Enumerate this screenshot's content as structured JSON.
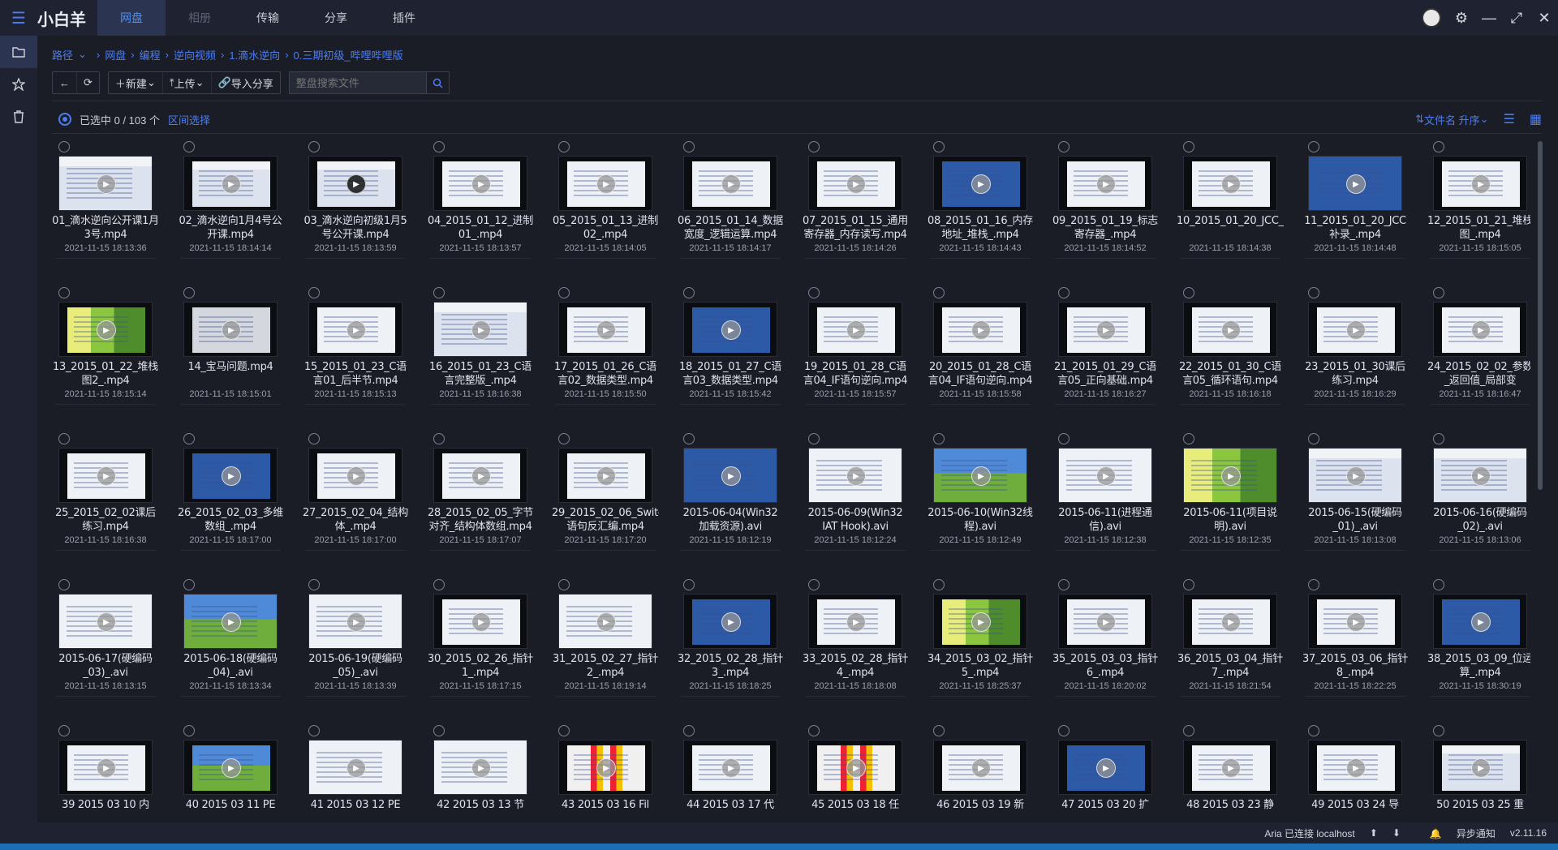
{
  "app": {
    "name": "小白羊"
  },
  "nav": {
    "tabs": [
      "网盘",
      "相册",
      "传输",
      "分享",
      "插件"
    ]
  },
  "breadcrumb": [
    "路径",
    "网盘",
    "编程",
    "逆向视频",
    "1.滴水逆向",
    "0.三期初级_哔哩哔哩版"
  ],
  "toolbar": {
    "new_label": "新建",
    "upload_label": "上传",
    "import_label": "导入分享",
    "search_placeholder": "整盘搜索文件"
  },
  "selection": {
    "count_text": "已选中 0 / 103 个",
    "range_label": "区间选择",
    "sort_label": "文件名 升序"
  },
  "files": [
    {
      "name": "01_滴水逆向公开课1月3号.mp4",
      "date": "2021-11-15 18:13:36",
      "style": "s-win",
      "full": true
    },
    {
      "name": "02_滴水逆向1月4号公开课.mp4",
      "date": "2021-11-15 18:14:14",
      "style": "s-win",
      "full": false
    },
    {
      "name": "03_滴水逆向初级1月5号公开课.mp4",
      "date": "2021-11-15 18:13:59",
      "style": "s-win",
      "full": false
    },
    {
      "name": "04_2015_01_12_进制01_.mp4",
      "date": "2021-11-15 18:13:57",
      "style": "s-white",
      "full": false
    },
    {
      "name": "05_2015_01_13_进制02_.mp4",
      "date": "2021-11-15 18:14:05",
      "style": "s-white",
      "full": false
    },
    {
      "name": "06_2015_01_14_数据宽度_逻辑运算.mp4",
      "date": "2021-11-15 18:14:17",
      "style": "s-white",
      "full": false
    },
    {
      "name": "07_2015_01_15_通用寄存器_内存读写.mp4",
      "date": "2021-11-15 18:14:26",
      "style": "s-white",
      "full": false
    },
    {
      "name": "08_2015_01_16_内存地址_堆栈_.mp4",
      "date": "2021-11-15 18:14:43",
      "style": "s-blue",
      "full": false
    },
    {
      "name": "09_2015_01_19_标志寄存器_.mp4",
      "date": "2021-11-15 18:14:52",
      "style": "s-white",
      "full": false
    },
    {
      "name": "10_2015_01_20_JCC_.mp4",
      "date": "2021-11-15 18:14:38",
      "style": "s-white",
      "full": false
    },
    {
      "name": "11_2015_01_20_JCC补录_.mp4",
      "date": "2021-11-15 18:14:48",
      "style": "s-blue",
      "full": true
    },
    {
      "name": "12_2015_01_21_堆栈图_.mp4",
      "date": "2021-11-15 18:15:05",
      "style": "s-white",
      "full": false
    },
    {
      "name": "13_2015_01_22_堆栈图2_.mp4",
      "date": "2021-11-15 18:15:14",
      "style": "s-green",
      "full": false
    },
    {
      "name": "14_宝马问题.mp4",
      "date": "2021-11-15 18:15:01",
      "style": "s-gray",
      "full": false
    },
    {
      "name": "15_2015_01_23_C语言01_后半节.mp4",
      "date": "2021-11-15 18:15:13",
      "style": "s-white",
      "full": false
    },
    {
      "name": "16_2015_01_23_C语言完整版_.mp4",
      "date": "2021-11-15 18:16:38",
      "style": "s-win",
      "full": true
    },
    {
      "name": "17_2015_01_26_C语言02_数据类型.mp4",
      "date": "2021-11-15 18:15:50",
      "style": "s-white",
      "full": false
    },
    {
      "name": "18_2015_01_27_C语言03_数据类型.mp4",
      "date": "2021-11-15 18:15:42",
      "style": "s-blue",
      "full": false
    },
    {
      "name": "19_2015_01_28_C语言04_IF语句逆向.mp4",
      "date": "2021-11-15 18:15:57",
      "style": "s-white",
      "full": false
    },
    {
      "name": "20_2015_01_28_C语言04_IF语句逆向.mp4",
      "date": "2021-11-15 18:15:58",
      "style": "s-white",
      "full": false
    },
    {
      "name": "21_2015_01_29_C语言05_正向基础.mp4",
      "date": "2021-11-15 18:16:27",
      "style": "s-white",
      "full": false
    },
    {
      "name": "22_2015_01_30_C语言05_循环语句.mp4",
      "date": "2021-11-15 18:16:18",
      "style": "s-white",
      "full": false
    },
    {
      "name": "23_2015_01_30课后练习.mp4",
      "date": "2021-11-15 18:16:29",
      "style": "s-white",
      "full": false
    },
    {
      "name": "24_2015_02_02_参数_返回值_局部变量.mp4",
      "date": "2021-11-15 18:16:47",
      "style": "s-white",
      "full": false
    },
    {
      "name": "25_2015_02_02课后练习.mp4",
      "date": "2021-11-15 18:16:38",
      "style": "s-white",
      "full": false
    },
    {
      "name": "26_2015_02_03_多维数组_.mp4",
      "date": "2021-11-15 18:17:00",
      "style": "s-blue",
      "full": false
    },
    {
      "name": "27_2015_02_04_结构体_.mp4",
      "date": "2021-11-15 18:17:00",
      "style": "s-white",
      "full": false
    },
    {
      "name": "28_2015_02_05_字节对齐_结构体数组.mp4",
      "date": "2021-11-15 18:17:07",
      "style": "s-white",
      "full": false
    },
    {
      "name": "29_2015_02_06_Switch语句反汇编.mp4",
      "date": "2021-11-15 18:17:20",
      "style": "s-white",
      "full": false
    },
    {
      "name": "2015-06-04(Win32 加载资源).avi",
      "date": "2021-11-15 18:12:19",
      "style": "s-blue",
      "full": true
    },
    {
      "name": "2015-06-09(Win32 IAT Hook).avi",
      "date": "2021-11-15 18:12:24",
      "style": "s-white",
      "full": true
    },
    {
      "name": "2015-06-10(Win32线程).avi",
      "date": "2021-11-15 18:12:49",
      "style": "s-xp",
      "full": true
    },
    {
      "name": "2015-06-11(进程通信).avi",
      "date": "2021-11-15 18:12:38",
      "style": "s-white",
      "full": true
    },
    {
      "name": "2015-06-11(项目说明).avi",
      "date": "2021-11-15 18:12:35",
      "style": "s-green",
      "full": true
    },
    {
      "name": "2015-06-15(硬编码_01)_.avi",
      "date": "2021-11-15 18:13:08",
      "style": "s-win",
      "full": true
    },
    {
      "name": "2015-06-16(硬编码_02)_.avi",
      "date": "2021-11-15 18:13:06",
      "style": "s-win",
      "full": true
    },
    {
      "name": "2015-06-17(硬编码_03)_.avi",
      "date": "2021-11-15 18:13:15",
      "style": "s-white",
      "full": true
    },
    {
      "name": "2015-06-18(硬编码_04)_.avi",
      "date": "2021-11-15 18:13:34",
      "style": "s-xp",
      "full": true
    },
    {
      "name": "2015-06-19(硬编码_05)_.avi",
      "date": "2021-11-15 18:13:39",
      "style": "s-white",
      "full": true
    },
    {
      "name": "30_2015_02_26_指针1_.mp4",
      "date": "2021-11-15 18:17:15",
      "style": "s-white",
      "full": false
    },
    {
      "name": "31_2015_02_27_指针2_.mp4",
      "date": "2021-11-15 18:19:14",
      "style": "s-white",
      "full": true
    },
    {
      "name": "32_2015_02_28_指针3_.mp4",
      "date": "2021-11-15 18:18:25",
      "style": "s-blue",
      "full": false
    },
    {
      "name": "33_2015_02_28_指针4_.mp4",
      "date": "2021-11-15 18:18:08",
      "style": "s-white",
      "full": false
    },
    {
      "name": "34_2015_03_02_指针5_.mp4",
      "date": "2021-11-15 18:25:37",
      "style": "s-green",
      "full": false
    },
    {
      "name": "35_2015_03_03_指针6_.mp4",
      "date": "2021-11-15 18:20:02",
      "style": "s-white",
      "full": false
    },
    {
      "name": "36_2015_03_04_指针7_.mp4",
      "date": "2021-11-15 18:21:54",
      "style": "s-white",
      "full": false
    },
    {
      "name": "37_2015_03_06_指针8_.mp4",
      "date": "2021-11-15 18:22:25",
      "style": "s-white",
      "full": false
    },
    {
      "name": "38_2015_03_09_位运算_.mp4",
      "date": "2021-11-15 18:30:19",
      "style": "s-blue",
      "full": false
    },
    {
      "name": "39 2015 03 10 内",
      "date": "",
      "style": "s-white",
      "full": false
    },
    {
      "name": "40 2015 03 11 PE",
      "date": "",
      "style": "s-xp",
      "full": false
    },
    {
      "name": "41 2015 03 12 PE",
      "date": "",
      "style": "s-white",
      "full": true
    },
    {
      "name": "42 2015 03 13 节",
      "date": "",
      "style": "s-white",
      "full": true
    },
    {
      "name": "43 2015 03 16 Fil",
      "date": "",
      "style": "s-bars",
      "full": false
    },
    {
      "name": "44 2015 03 17 代",
      "date": "",
      "style": "s-white",
      "full": false
    },
    {
      "name": "45 2015 03 18 任",
      "date": "",
      "style": "s-bars",
      "full": false
    },
    {
      "name": "46 2015 03 19 新",
      "date": "",
      "style": "s-white",
      "full": false
    },
    {
      "name": "47 2015 03 20 扩",
      "date": "",
      "style": "s-blue",
      "full": false
    },
    {
      "name": "48 2015 03 23 静",
      "date": "",
      "style": "s-white",
      "full": false
    },
    {
      "name": "49 2015 03 24 导",
      "date": "",
      "style": "s-white",
      "full": false
    },
    {
      "name": "50 2015 03 25 重",
      "date": "",
      "style": "s-win",
      "full": false
    }
  ],
  "status": {
    "aria": "Aria 已连接 localhost",
    "notify": "异步通知",
    "version": "v2.11.16"
  }
}
